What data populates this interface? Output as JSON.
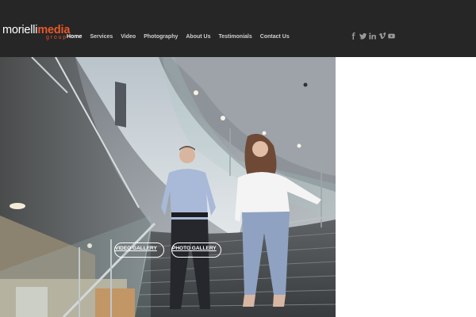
{
  "brand": {
    "logo_text_light": "morielli",
    "logo_text_accent": "media",
    "logo_sub": "group"
  },
  "nav": {
    "items": [
      {
        "label": "Home",
        "active": true
      },
      {
        "label": "Services",
        "active": false
      },
      {
        "label": "Video",
        "active": false
      },
      {
        "label": "Photography",
        "active": false
      },
      {
        "label": "About Us",
        "active": false
      },
      {
        "label": "Testimonials",
        "active": false
      },
      {
        "label": "Contact Us",
        "active": false
      }
    ]
  },
  "social": [
    "facebook-icon",
    "twitter-icon",
    "linkedin-icon",
    "vimeo-icon",
    "youtube-icon"
  ],
  "hero": {
    "video_gallery_label": "VIDEO GALLERY",
    "photo_gallery_label": "PHOTO GALLERY"
  },
  "colors": {
    "header_bg": "#262626",
    "accent": "#e8572a",
    "nav_text": "#cfcfcf"
  }
}
